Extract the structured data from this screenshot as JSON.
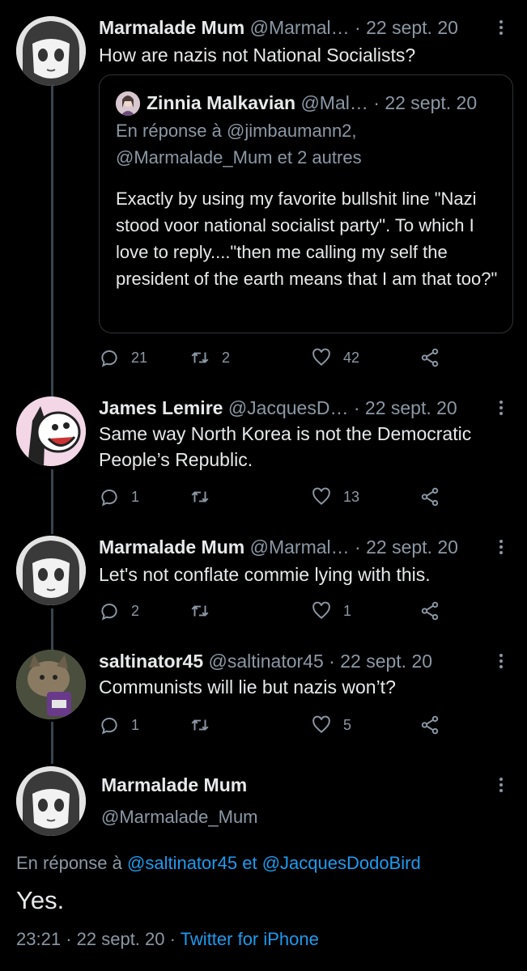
{
  "tweets": [
    {
      "name": "Marmalade Mum",
      "handle": "@Marmal…",
      "date": "22 sept. 20",
      "text": "How are nazis not National Socialists?",
      "quote": {
        "name": "Zinnia Malkavian",
        "handle": "@Mal…",
        "date": "22 sept. 20",
        "reply_prefix": "En réponse à",
        "reply_targets": "@jimbaumann2, @Marmalade_Mum et 2 autres",
        "text": "Exactly by using my favorite bullshit line \"Nazi stood voor national socialist party\". To which I love to reply....\"then me calling my self the president of the earth means that I am that too?\""
      },
      "replies": "21",
      "retweets": "2",
      "likes": "42"
    },
    {
      "name": "James Lemire",
      "handle": "@JacquesD…",
      "date": "22 sept. 20",
      "text": "Same way North Korea is not the Democratic People’s Republic.",
      "replies": "1",
      "retweets": "",
      "likes": "13"
    },
    {
      "name": "Marmalade Mum",
      "handle": "@Marmal…",
      "date": "22 sept. 20",
      "text": "Let's not conflate commie lying with this.",
      "replies": "2",
      "retweets": "",
      "likes": "1"
    },
    {
      "name": "saltinator45",
      "handle": "@saltinator45",
      "date": "22 sept. 20",
      "text": "Communists will lie but nazis won’t?",
      "replies": "1",
      "retweets": "",
      "likes": "5"
    }
  ],
  "main": {
    "name": "Marmalade Mum",
    "handle": "@Marmalade_Mum",
    "reply_prefix": "En réponse à",
    "reply_target1": "@saltinator45",
    "reply_conj": "et",
    "reply_target2": "@JacquesDodoBird",
    "text": "Yes.",
    "time": "23:21",
    "date": "22 sept. 20",
    "source": "Twitter for iPhone"
  },
  "separator": "·",
  "icons": [
    "reply-icon",
    "retweet-icon",
    "like-icon",
    "share-icon",
    "more-icon"
  ],
  "colors": {
    "background": "#000000",
    "text": "#e7e9ea",
    "muted": "#8b98a5",
    "link": "#1d9bf0",
    "thread_line": "#38444d"
  }
}
